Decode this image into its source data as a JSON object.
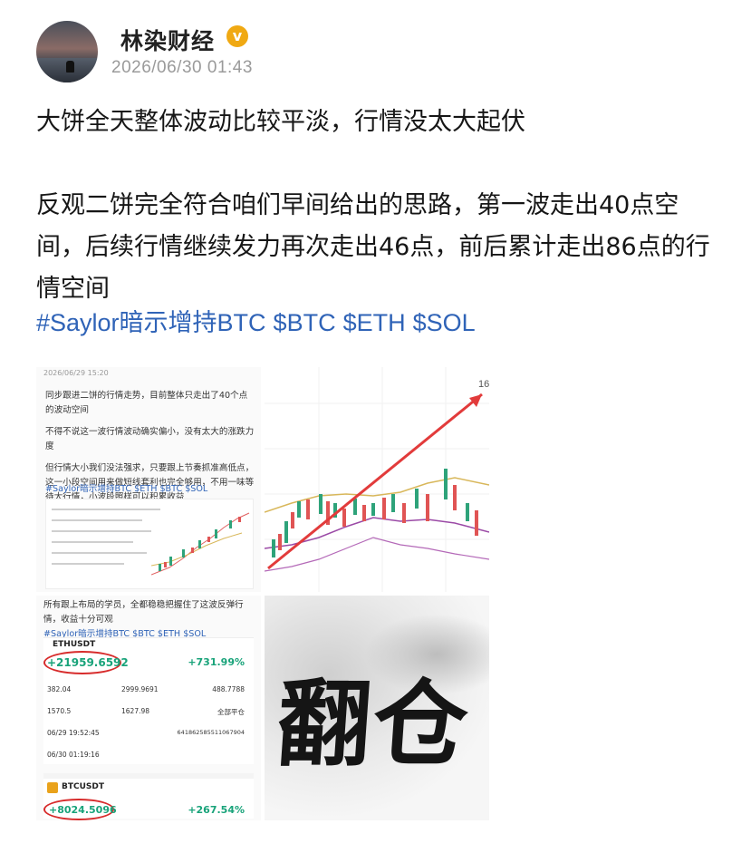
{
  "author": {
    "name": "林染财经",
    "verified_badge": "v",
    "timestamp": "2026/06/30 01:43"
  },
  "post": {
    "paragraph_1": "大饼全天整体波动比较平淡，行情没太大起伏",
    "paragraph_2": "反观二饼完全符合咱们早间给出的思路，第一波走出40点空间，后续行情继续发力再次走出46点，前后累计走出86点的行情空间",
    "hashtags": [
      "#Saylor暗示增持BTC",
      "$BTC",
      "$ETH",
      "$SOL"
    ]
  },
  "images": {
    "tile1": {
      "header": "2026/06/29 15:20",
      "line_1": "同步跟进二饼的行情走势，目前整体只走出了40个点的波动空间",
      "line_2": "不得不说这一波行情波动确实偏小，没有太大的涨跌力度",
      "line_3": "但行情大小我们没法强求，只要跟上节奏抓准高低点，这一小段空间用来做短线套利也完全够用，不用一味等待大行情，小波段照样可以积累收益",
      "tags": "#Saylor暗示增持BTC $ETH $BTC $SOL"
    },
    "tile2": {
      "price_label": "16"
    },
    "tile3": {
      "top_text": "所有跟上布局的学员，全都稳稳把握住了这波反弹行情，收益十分可观",
      "tags": "#Saylor暗示增持BTC $BTC $ETH $SOL",
      "eth": {
        "symbol": "ETHUSDT",
        "pnl": "+21959.6592",
        "pct": "+731.99%",
        "values": [
          "382.04",
          "2999.9691",
          "488.7788",
          "1570.5",
          "1627.98",
          "全部平仓",
          "06/29 19:52:45",
          "641862585511067904",
          "06/30 01:19:16"
        ]
      },
      "btc": {
        "symbol": "BTCUSDT",
        "pnl": "+8024.5096",
        "pct": "+267.54%"
      }
    },
    "tile4": {
      "calligraphy": "翻仓"
    }
  },
  "colors": {
    "hashtag": "#2f63b7",
    "profit_green": "#19a37a",
    "annotation_red": "#d72b2b",
    "verified_gold": "#f0a913"
  }
}
